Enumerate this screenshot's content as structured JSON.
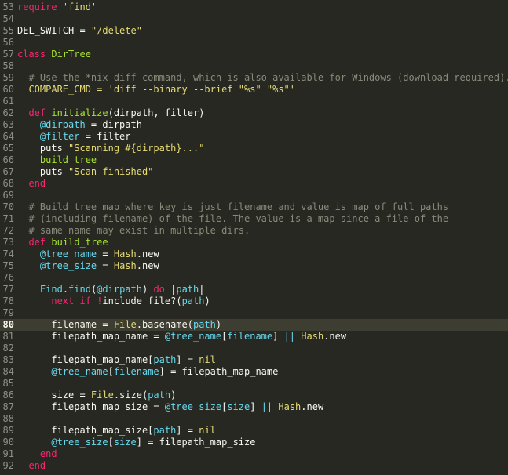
{
  "editor": {
    "current_line": "80",
    "lines": [
      {
        "num": "53",
        "tokens": [
          {
            "k": "kw",
            "t": "require"
          },
          {
            "k": "pln",
            "t": " "
          },
          {
            "k": "str",
            "t": "'find'"
          }
        ]
      },
      {
        "num": "54",
        "tokens": []
      },
      {
        "num": "55",
        "tokens": [
          {
            "k": "pln",
            "t": "DEL_SWITCH = "
          },
          {
            "k": "str",
            "t": "\"/delete\""
          }
        ]
      },
      {
        "num": "56",
        "tokens": []
      },
      {
        "num": "57",
        "tokens": [
          {
            "k": "kw",
            "t": "class"
          },
          {
            "k": "pln",
            "t": " "
          },
          {
            "k": "cls",
            "t": "DirTree"
          }
        ]
      },
      {
        "num": "58",
        "tokens": []
      },
      {
        "num": "59",
        "tokens": [
          {
            "k": "pln",
            "t": "  "
          },
          {
            "k": "cmt",
            "t": "# Use the *nix diff command, which is also available for Windows (download required)."
          }
        ]
      },
      {
        "num": "60",
        "tokens": [
          {
            "k": "pln",
            "t": "  "
          },
          {
            "k": "str",
            "t": "COMPARE_CMD = 'diff --binary --brief \"%s\" \"%s\"'"
          }
        ]
      },
      {
        "num": "61",
        "tokens": []
      },
      {
        "num": "62",
        "tokens": [
          {
            "k": "pln",
            "t": "  "
          },
          {
            "k": "kw",
            "t": "def"
          },
          {
            "k": "pln",
            "t": " "
          },
          {
            "k": "fn",
            "t": "initialize"
          },
          {
            "k": "pln",
            "t": "(dirpath, filter)"
          }
        ]
      },
      {
        "num": "63",
        "tokens": [
          {
            "k": "pln",
            "t": "    "
          },
          {
            "k": "var",
            "t": "@dirpath"
          },
          {
            "k": "pln",
            "t": " = dirpath"
          }
        ]
      },
      {
        "num": "64",
        "tokens": [
          {
            "k": "pln",
            "t": "    "
          },
          {
            "k": "var",
            "t": "@filter"
          },
          {
            "k": "pln",
            "t": " = filter"
          }
        ]
      },
      {
        "num": "65",
        "tokens": [
          {
            "k": "pln",
            "t": "    puts "
          },
          {
            "k": "str",
            "t": "\"Scanning #{dirpath}...\""
          }
        ]
      },
      {
        "num": "66",
        "tokens": [
          {
            "k": "pln",
            "t": "    "
          },
          {
            "k": "fn",
            "t": "build_tree"
          }
        ]
      },
      {
        "num": "67",
        "tokens": [
          {
            "k": "pln",
            "t": "    puts "
          },
          {
            "k": "str",
            "t": "\"Scan finished\""
          }
        ]
      },
      {
        "num": "68",
        "tokens": [
          {
            "k": "pln",
            "t": "  "
          },
          {
            "k": "kw",
            "t": "end"
          }
        ]
      },
      {
        "num": "69",
        "tokens": []
      },
      {
        "num": "70",
        "tokens": [
          {
            "k": "pln",
            "t": "  "
          },
          {
            "k": "cmt",
            "t": "# Build tree map where key is just filename and value is map of full paths"
          }
        ]
      },
      {
        "num": "71",
        "tokens": [
          {
            "k": "pln",
            "t": "  "
          },
          {
            "k": "cmt",
            "t": "# (including filename) of the file. The value is a map since a file of the"
          }
        ]
      },
      {
        "num": "72",
        "tokens": [
          {
            "k": "pln",
            "t": "  "
          },
          {
            "k": "cmt",
            "t": "# same name may exist in multiple dirs."
          }
        ]
      },
      {
        "num": "73",
        "tokens": [
          {
            "k": "pln",
            "t": "  "
          },
          {
            "k": "kw",
            "t": "def"
          },
          {
            "k": "pln",
            "t": " "
          },
          {
            "k": "fn",
            "t": "build_tree"
          }
        ]
      },
      {
        "num": "74",
        "tokens": [
          {
            "k": "pln",
            "t": "    "
          },
          {
            "k": "var",
            "t": "@tree_name"
          },
          {
            "k": "pln",
            "t": " = "
          },
          {
            "k": "typ",
            "t": "Hash"
          },
          {
            "k": "pln",
            "t": ".new"
          }
        ]
      },
      {
        "num": "75",
        "tokens": [
          {
            "k": "pln",
            "t": "    "
          },
          {
            "k": "var",
            "t": "@tree_size"
          },
          {
            "k": "pln",
            "t": " = "
          },
          {
            "k": "typ",
            "t": "Hash"
          },
          {
            "k": "pln",
            "t": ".new"
          }
        ]
      },
      {
        "num": "76",
        "tokens": []
      },
      {
        "num": "77",
        "tokens": [
          {
            "k": "pln",
            "t": "    "
          },
          {
            "k": "var",
            "t": "Find"
          },
          {
            "k": "pln",
            "t": "."
          },
          {
            "k": "var",
            "t": "find"
          },
          {
            "k": "pln",
            "t": "("
          },
          {
            "k": "var",
            "t": "@dirpath"
          },
          {
            "k": "pln",
            "t": ") "
          },
          {
            "k": "kw",
            "t": "do"
          },
          {
            "k": "pln",
            "t": " |"
          },
          {
            "k": "var",
            "t": "path"
          },
          {
            "k": "pln",
            "t": "|"
          }
        ]
      },
      {
        "num": "78",
        "tokens": [
          {
            "k": "pln",
            "t": "      "
          },
          {
            "k": "kw",
            "t": "next"
          },
          {
            "k": "pln",
            "t": " "
          },
          {
            "k": "kw",
            "t": "if"
          },
          {
            "k": "pln",
            "t": " "
          },
          {
            "k": "kw",
            "t": "!"
          },
          {
            "k": "pln",
            "t": "include_file?("
          },
          {
            "k": "var",
            "t": "path"
          },
          {
            "k": "pln",
            "t": ")"
          }
        ]
      },
      {
        "num": "79",
        "tokens": []
      },
      {
        "num": "80",
        "tokens": [
          {
            "k": "pln",
            "t": "      filename = "
          },
          {
            "k": "typ",
            "t": "File"
          },
          {
            "k": "pln",
            "t": ".basename("
          },
          {
            "k": "var",
            "t": "path"
          },
          {
            "k": "pln",
            "t": ")"
          }
        ]
      },
      {
        "num": "81",
        "tokens": [
          {
            "k": "pln",
            "t": "      filepath_map_name = "
          },
          {
            "k": "var",
            "t": "@tree_name"
          },
          {
            "k": "pln",
            "t": "["
          },
          {
            "k": "var",
            "t": "filename"
          },
          {
            "k": "pln",
            "t": "] "
          },
          {
            "k": "var",
            "t": "||"
          },
          {
            "k": "pln",
            "t": " "
          },
          {
            "k": "typ",
            "t": "Hash"
          },
          {
            "k": "pln",
            "t": ".new"
          }
        ]
      },
      {
        "num": "82",
        "tokens": []
      },
      {
        "num": "83",
        "tokens": [
          {
            "k": "pln",
            "t": "      filepath_map_name["
          },
          {
            "k": "var",
            "t": "path"
          },
          {
            "k": "pln",
            "t": "] = "
          },
          {
            "k": "typ",
            "t": "nil"
          }
        ]
      },
      {
        "num": "84",
        "tokens": [
          {
            "k": "pln",
            "t": "      "
          },
          {
            "k": "var",
            "t": "@tree_name"
          },
          {
            "k": "pln",
            "t": "["
          },
          {
            "k": "var",
            "t": "filename"
          },
          {
            "k": "pln",
            "t": "] = filepath_map_name"
          }
        ]
      },
      {
        "num": "85",
        "tokens": []
      },
      {
        "num": "86",
        "tokens": [
          {
            "k": "pln",
            "t": "      size = "
          },
          {
            "k": "typ",
            "t": "File"
          },
          {
            "k": "pln",
            "t": ".size("
          },
          {
            "k": "var",
            "t": "path"
          },
          {
            "k": "pln",
            "t": ")"
          }
        ]
      },
      {
        "num": "87",
        "tokens": [
          {
            "k": "pln",
            "t": "      filepath_map_size = "
          },
          {
            "k": "var",
            "t": "@tree_size"
          },
          {
            "k": "pln",
            "t": "["
          },
          {
            "k": "var",
            "t": "size"
          },
          {
            "k": "pln",
            "t": "] "
          },
          {
            "k": "var",
            "t": "||"
          },
          {
            "k": "pln",
            "t": " "
          },
          {
            "k": "typ",
            "t": "Hash"
          },
          {
            "k": "pln",
            "t": ".new"
          }
        ]
      },
      {
        "num": "88",
        "tokens": []
      },
      {
        "num": "89",
        "tokens": [
          {
            "k": "pln",
            "t": "      filepath_map_size["
          },
          {
            "k": "var",
            "t": "path"
          },
          {
            "k": "pln",
            "t": "] = "
          },
          {
            "k": "typ",
            "t": "nil"
          }
        ]
      },
      {
        "num": "90",
        "tokens": [
          {
            "k": "pln",
            "t": "      "
          },
          {
            "k": "var",
            "t": "@tree_size"
          },
          {
            "k": "pln",
            "t": "["
          },
          {
            "k": "var",
            "t": "size"
          },
          {
            "k": "pln",
            "t": "] = filepath_map_size"
          }
        ]
      },
      {
        "num": "91",
        "tokens": [
          {
            "k": "pln",
            "t": "    "
          },
          {
            "k": "kw",
            "t": "end"
          }
        ]
      },
      {
        "num": "92",
        "tokens": [
          {
            "k": "pln",
            "t": "  "
          },
          {
            "k": "kw",
            "t": "end"
          }
        ]
      }
    ]
  },
  "theme": {
    "background": "#272822",
    "current_line_background": "#3e3d32",
    "keyword": "#f92672",
    "string": "#e6db74",
    "function": "#a6e22e",
    "variable": "#66d9ef",
    "comment": "#8a8a7a",
    "gutter": "#8f908a"
  }
}
